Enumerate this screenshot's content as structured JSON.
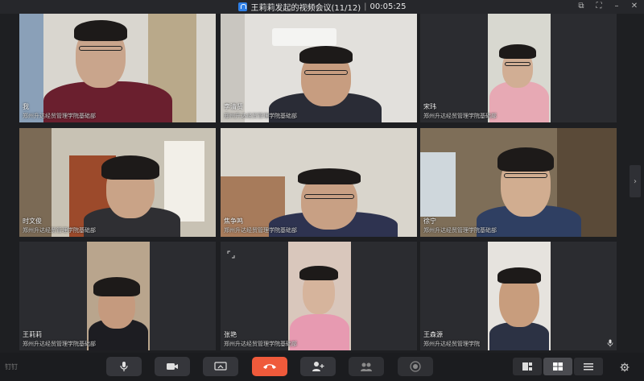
{
  "window": {
    "title": "王莉莉发起的视频会议(11/12)",
    "separator": "|",
    "timer": "00:05:25"
  },
  "participants": [
    {
      "name": "我",
      "org": "郑州升达经贸管理学院基础部"
    },
    {
      "name": "李清贤",
      "org": "郑州升达经贸管理学院基础部"
    },
    {
      "name": "宋玮",
      "org": "郑州升达经贸管理学院基础部"
    },
    {
      "name": "时文俊",
      "org": "郑州升达经贸管理学院基础部"
    },
    {
      "name": "焦争鸣",
      "org": "郑州升达经贸管理学院基础部"
    },
    {
      "name": "徐宁",
      "org": "郑州升达经贸管理学院基础部"
    },
    {
      "name": "王莉莉",
      "org": "郑州升达经贸管理学院基础部"
    },
    {
      "name": "张艳",
      "org": "郑州升达经贸管理学院基础部"
    },
    {
      "name": "王森源",
      "org": "郑州升达经贸管理学院"
    }
  ],
  "toolbar": {
    "logo": "钉钉",
    "buttons": [
      "mic-icon",
      "camera-icon",
      "screen-share-icon",
      "hang-up-icon",
      "add-member-icon",
      "members-icon",
      "record-icon"
    ]
  },
  "colors": {
    "end_call": "#ef5a3b",
    "accent": "#2e7fe6"
  }
}
